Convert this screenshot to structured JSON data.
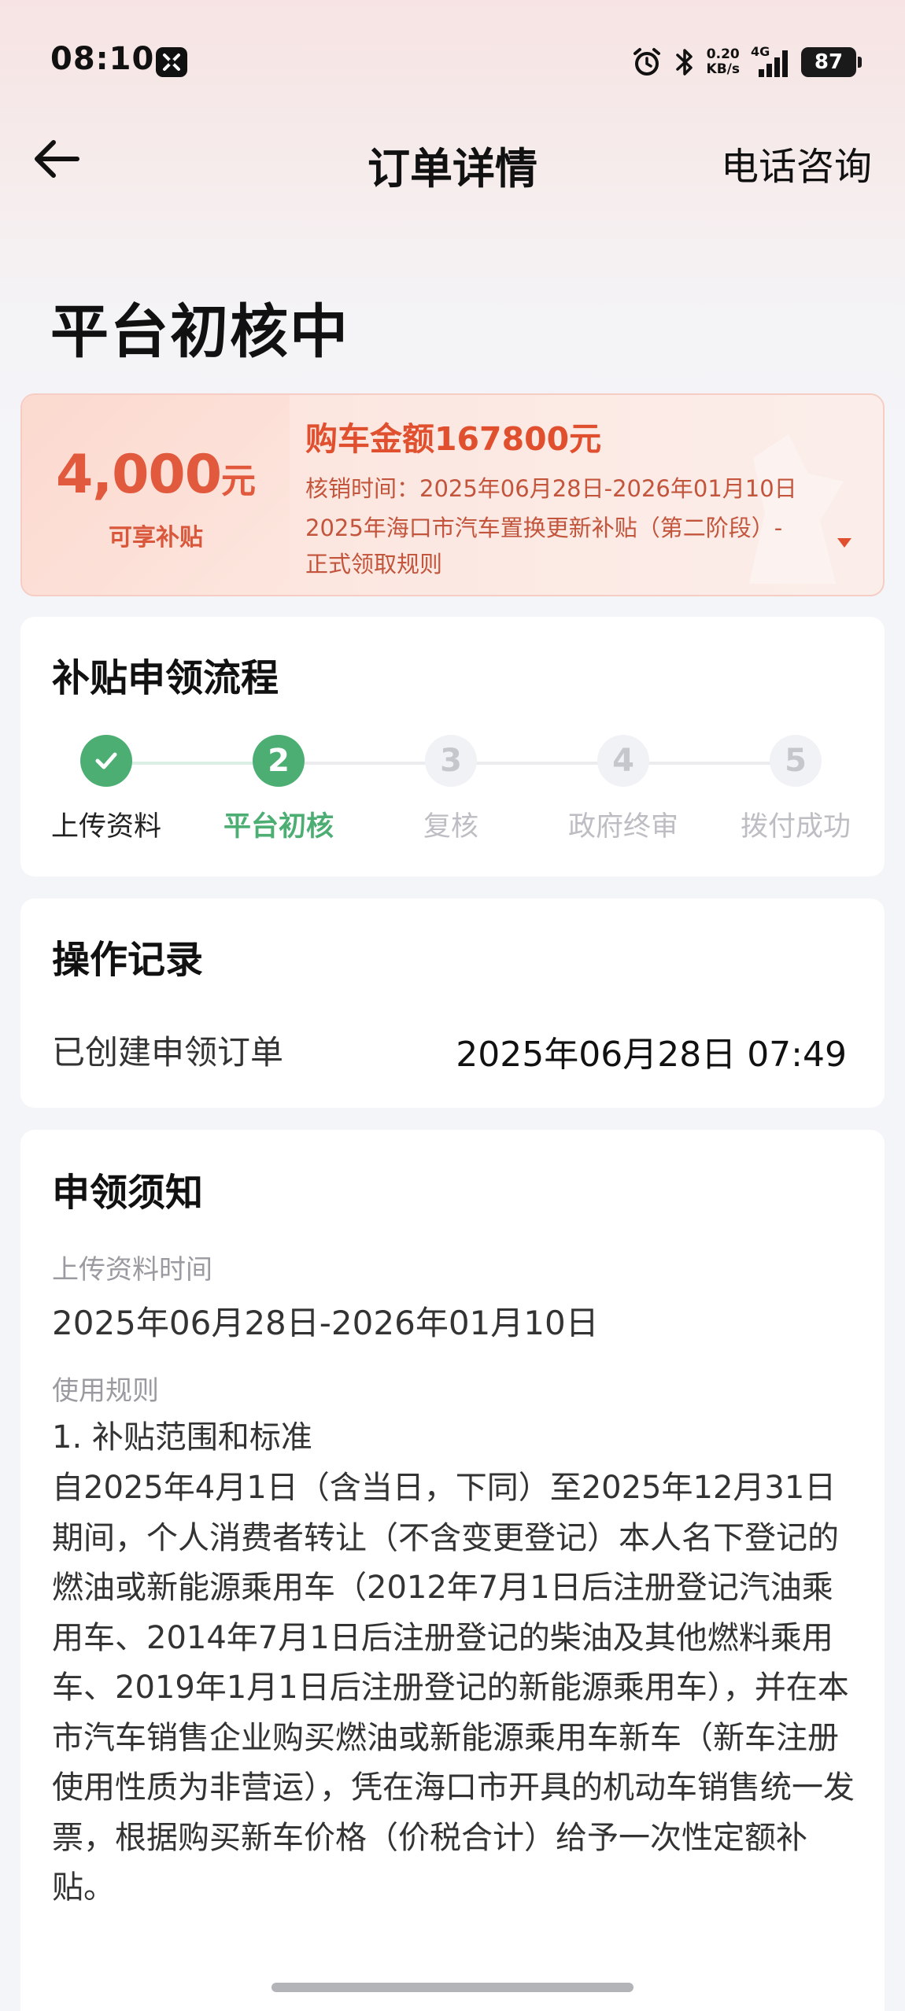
{
  "status_bar": {
    "time": "08:10",
    "net_speed_value": "0.20",
    "net_speed_unit": "KB/s",
    "network": "4G",
    "battery": "87",
    "icons": [
      "alarm-icon",
      "bluetooth-icon",
      "signal-icon"
    ]
  },
  "nav": {
    "back_icon": "arrow-left-icon",
    "title": "订单详情",
    "right_action": "电话咨询"
  },
  "status_title": "平台初核中",
  "subsidy": {
    "amount": "4,000",
    "unit": "元",
    "note": "可享补贴",
    "purchase_amount": "购车金额167800元",
    "verify_time": "核销时间：2025年06月28日-2026年01月10日",
    "policy": "2025年海口市汽车置换更新补贴（第二阶段）-正式领取规则",
    "colors": {
      "accent": "#e0502f",
      "background": "#fde3db"
    }
  },
  "process": {
    "title": "补贴申领流程",
    "steps": [
      {
        "num": "1",
        "label": "上传资料",
        "state": "done"
      },
      {
        "num": "2",
        "label": "平台初核",
        "state": "current"
      },
      {
        "num": "3",
        "label": "复核",
        "state": "todo"
      },
      {
        "num": "4",
        "label": "政府终审",
        "state": "todo"
      },
      {
        "num": "5",
        "label": "拨付成功",
        "state": "todo"
      }
    ],
    "colors": {
      "active": "#4cae73",
      "inactive": "#c6c7cc"
    }
  },
  "records": {
    "title": "操作记录",
    "items": [
      {
        "name": "已创建申领订单",
        "time": "2025年06月28日 07:49"
      }
    ]
  },
  "notice": {
    "title": "申领须知",
    "upload_time_label": "上传资料时间",
    "upload_time_value": "2025年06月28日-2026年01月10日",
    "rules_label": "使用规则",
    "rule_heading": "1. 补贴范围和标准",
    "rule_text": "自2025年4月1日（含当日，下同）至2025年12月31日期间，个人消费者转让（不含变更登记）本人名下登记的燃油或新能源乘用车（2012年7月1日后注册登记汽油乘用车、2014年7月1日后注册登记的柴油及其他燃料乘用车、2019年1月1日后注册登记的新能源乘用车），并在本市汽车销售企业购买燃油或新能源乘用车新车（新车注册使用性质为非营运），凭在海口市开具的机动车销售统一发票，根据购买新车价格（价税合计）给予一次性定额补贴。"
  }
}
